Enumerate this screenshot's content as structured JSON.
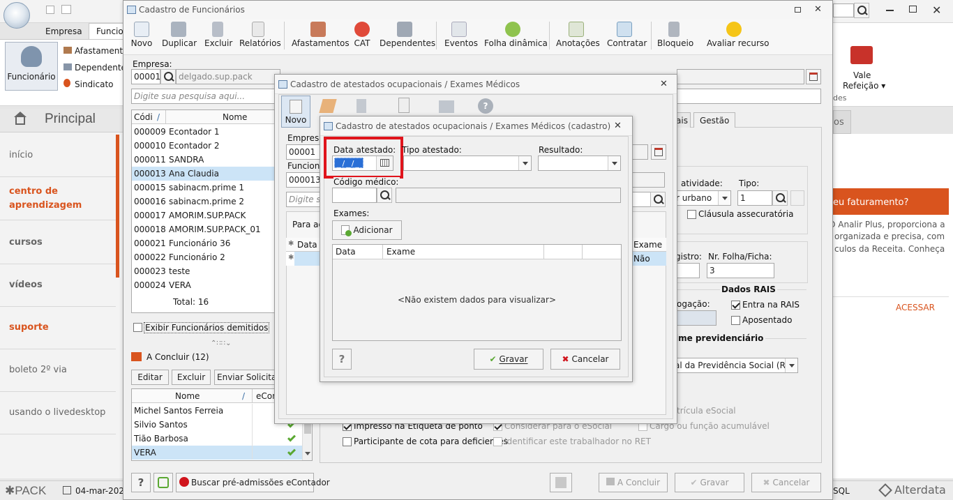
{
  "app": {
    "ribbon_tabs": [
      "Empresa",
      "Funcio"
    ],
    "ribbon_group": {
      "main_label": "Funcionário",
      "items": [
        "Afastament",
        "Dependente",
        "Sindicato"
      ]
    },
    "nav_title": "Principal",
    "nav_items": [
      {
        "label": "início",
        "style": "normal"
      },
      {
        "label": "centro de aprendizagem",
        "style": "accent"
      },
      {
        "label": "cursos",
        "style": "bold"
      },
      {
        "label": "vídeos",
        "style": "bold"
      },
      {
        "label": "suporte",
        "style": "accent"
      },
      {
        "label": "boleto 2º via",
        "style": "normal"
      },
      {
        "label": "usando o livedesktop",
        "style": "normal"
      }
    ],
    "status": {
      "brand": "PACK",
      "date": "04-mar-202",
      "sql": "SQL",
      "vendor": "Alterdata"
    },
    "right_ribbon": {
      "vale": "Vale",
      "refeicao": "Refeição",
      "ides": "des",
      "tab": "os"
    },
    "promo": {
      "title": "eu faturamento?",
      "line1": "O Analir Plus, proporciona a",
      "line2": "organizada e precisa, com",
      "line3": "culos da Receita. Conheça",
      "cta": "ACESSAR"
    },
    "colors": {
      "accent": "#d9541e",
      "red_highlight": "#e0141c",
      "check_green": "#5aa832"
    }
  },
  "main": {
    "title": "Cadastro de Funcionários",
    "toolbar": [
      "Novo",
      "Duplicar",
      "Excluir",
      "Relatórios",
      "Afastamentos",
      "CAT",
      "Dependentes",
      "Eventos",
      "Folha dinâmica",
      "Anotações",
      "Contratar",
      "Bloqueio",
      "Avaliar recurso"
    ],
    "empresa_label": "Empresa:",
    "empresa_code": "00001",
    "empresa_name": "delgado.sup.pack",
    "search_placeholder": "Digite sua pesquisa aqui...",
    "list_headers": {
      "code": "Códi",
      "name": "Nome"
    },
    "employees": [
      {
        "code": "000009",
        "name": "Econtador 1",
        "selected": false
      },
      {
        "code": "000010",
        "name": "Econtador 2",
        "selected": false
      },
      {
        "code": "000011",
        "name": "SANDRA",
        "selected": false
      },
      {
        "code": "000013",
        "name": "Ana Claudia",
        "selected": true
      },
      {
        "code": "000015",
        "name": "sabinacm.prime 1",
        "selected": false
      },
      {
        "code": "000016",
        "name": "sabinacm.prime 2",
        "selected": false
      },
      {
        "code": "000017",
        "name": "AMORIM.SUP.PACK",
        "selected": false
      },
      {
        "code": "000018",
        "name": "AMORIM.SUP.PACK_01",
        "selected": false
      },
      {
        "code": "000021",
        "name": "Funcionário 36",
        "selected": false
      },
      {
        "code": "000022",
        "name": "Funcionário 2",
        "selected": false
      },
      {
        "code": "000023",
        "name": "teste",
        "selected": false
      },
      {
        "code": "000024",
        "name": "VERA",
        "selected": false
      }
    ],
    "total": "Total: 16",
    "show_fired": "Exibir Funcionários demitidos",
    "pending_title": "A Concluir (12)",
    "pending_buttons": [
      "Editar",
      "Excluir",
      "Enviar Solicitaçã"
    ],
    "pending_headers": {
      "name": "Nome",
      "econ": "eCon"
    },
    "pending": [
      {
        "name": "Michel Santos Ferreia",
        "ok": false,
        "selected": false
      },
      {
        "name": "Silvio Santos",
        "ok": true,
        "selected": false
      },
      {
        "name": "Tião Barbosa",
        "ok": true,
        "selected": false
      },
      {
        "name": "VERA",
        "ok": true,
        "selected": true
      }
    ],
    "buscar": "Buscar pré-admissões eContador",
    "bottom_buttons": {
      "concluir": "A Concluir",
      "gravar": "Gravar",
      "cancelar": "Cancelar"
    },
    "right_tabs": [
      "ais",
      "Gestão"
    ],
    "form": {
      "atividade_label": "atividade:",
      "atividade_value": "r urbano",
      "tipo_label": "Tipo:",
      "tipo_value": "1",
      "clausula": "Cláusula assecuratória",
      "registro_label": "gistro:",
      "folha_label": "Nr. Folha/Ficha:",
      "folha_value": "3",
      "rais_title": "Dados RAIS",
      "prorrogacao_label": "ogação:",
      "entra_rais": "Entra na RAIS",
      "aposentado": "Aposentado",
      "regime_title": "ime previdenciário",
      "regime_value": "al da Previdência Social (RGP",
      "matricula": "trícula eSocial",
      "impresso": "Impresso na Etiqueta de ponto",
      "considerar": "Considerar para o eSocial",
      "cargo": "Cargo ou função acumulável",
      "participante": "Participante de cota para deficientes",
      "identificar": "Identificar este trabalhador no RET"
    }
  },
  "mid": {
    "title": "Cadastro de atestados ocupacionais / Exames Médicos",
    "novo": "Novo",
    "empresa_label": "Empresa",
    "empresa_code": "00001",
    "func_label": "Funciona",
    "func_code": "000013",
    "search_placeholder": "Digite sua",
    "para_ag": "Para ag",
    "grid_data": "Data",
    "grid_exame": "Exame",
    "grid_nao": "Não"
  },
  "dialog": {
    "title": "Cadastro de atestados ocupacionais / Exames Médicos (cadastro)",
    "data_label": "Data atestado:",
    "data_value": "_/_/_",
    "tipo_label": "Tipo atestado:",
    "resultado_label": "Resultado:",
    "codigo_label": "Código médico:",
    "exames_label": "Exames:",
    "adicionar": "Adicionar",
    "grid_headers": [
      "Data",
      "Exame"
    ],
    "empty": "<Não existem dados para visualizar>",
    "help": "?",
    "gravar": "Gravar",
    "cancelar": "Cancelar"
  }
}
